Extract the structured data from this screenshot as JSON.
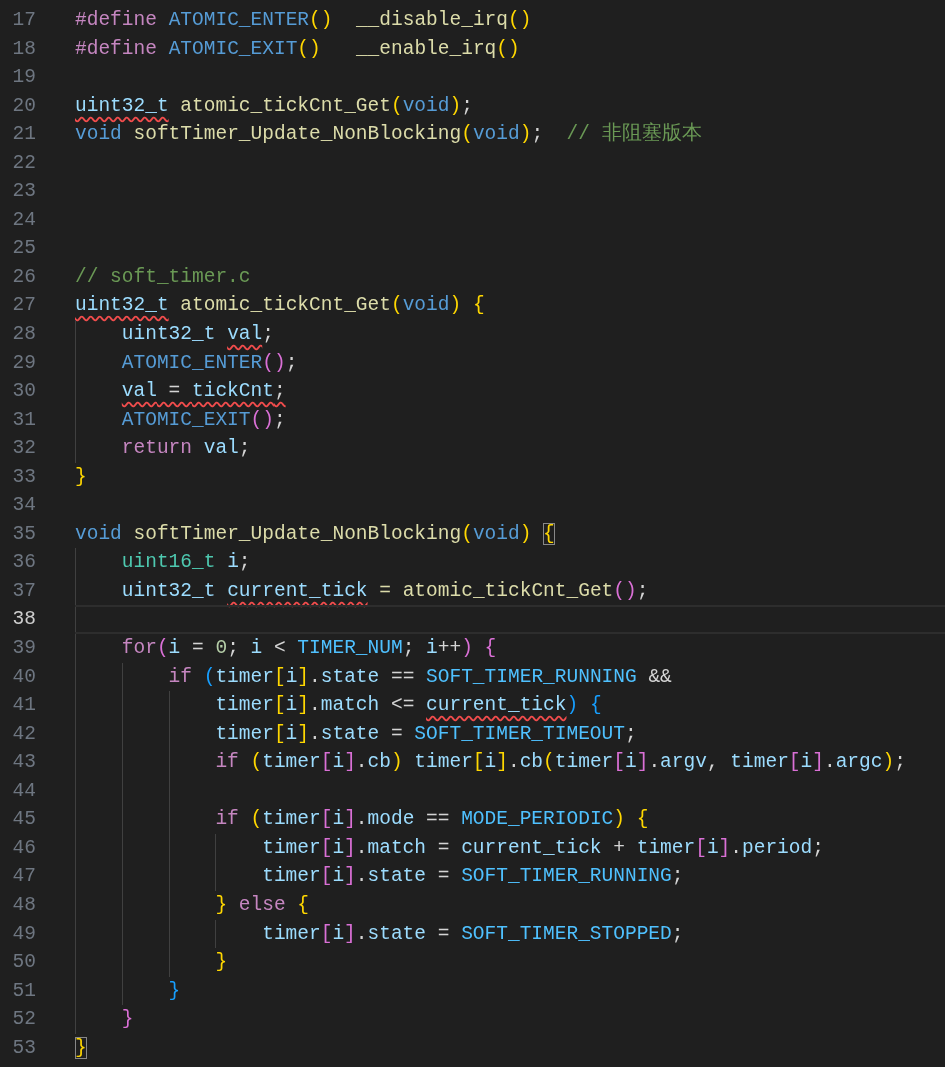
{
  "editor": {
    "lines": [
      {
        "number": "17",
        "current": false,
        "tokens": [
          {
            "text": "#define ",
            "kind": "keyword",
            "squiggle": false,
            "matched": false
          },
          {
            "text": "ATOMIC_ENTER",
            "kind": "macro",
            "squiggle": false,
            "matched": false
          },
          {
            "text": "()  ",
            "kind": "bracket1",
            "squiggle": false,
            "matched": false
          },
          {
            "text": "__disable_irq",
            "kind": "function",
            "squiggle": false,
            "matched": false
          },
          {
            "text": "()",
            "kind": "bracket1",
            "squiggle": false,
            "matched": false
          }
        ]
      },
      {
        "number": "18",
        "current": false,
        "tokens": [
          {
            "text": "#define ",
            "kind": "keyword",
            "squiggle": false,
            "matched": false
          },
          {
            "text": "ATOMIC_EXIT",
            "kind": "macro",
            "squiggle": false,
            "matched": false
          },
          {
            "text": "()   ",
            "kind": "bracket1",
            "squiggle": false,
            "matched": false
          },
          {
            "text": "__enable_irq",
            "kind": "function",
            "squiggle": false,
            "matched": false
          },
          {
            "text": "()",
            "kind": "bracket1",
            "squiggle": false,
            "matched": false
          }
        ]
      },
      {
        "number": "19",
        "current": false
      },
      {
        "number": "20",
        "current": false,
        "tokens": [
          {
            "text": "uint32_t",
            "kind": "variable",
            "squiggle": true,
            "matched": false
          },
          {
            "text": " atomic_tickCnt_Get",
            "kind": "function",
            "squiggle": false,
            "matched": false
          },
          {
            "text": "(",
            "kind": "bracket1",
            "squiggle": false,
            "matched": false
          },
          {
            "text": "void",
            "kind": "storage",
            "squiggle": false,
            "matched": false
          },
          {
            "text": ")",
            "kind": "bracket1",
            "squiggle": false,
            "matched": false
          },
          {
            "text": ";",
            "kind": "plain",
            "squiggle": false,
            "matched": false
          }
        ]
      },
      {
        "number": "21",
        "current": false,
        "tokens": [
          {
            "text": "void ",
            "kind": "storage",
            "squiggle": false,
            "matched": false
          },
          {
            "text": "softTimer_Update_NonBlocking",
            "kind": "function",
            "squiggle": false,
            "matched": false
          },
          {
            "text": "(",
            "kind": "bracket1",
            "squiggle": false,
            "matched": false
          },
          {
            "text": "void",
            "kind": "storage",
            "squiggle": false,
            "matched": false
          },
          {
            "text": ")",
            "kind": "bracket1",
            "squiggle": false,
            "matched": false
          },
          {
            "text": ";  ",
            "kind": "plain",
            "squiggle": false,
            "matched": false
          },
          {
            "text": "// 非阻塞版本",
            "kind": "comment",
            "squiggle": false,
            "matched": false
          }
        ]
      },
      {
        "number": "22",
        "current": false
      },
      {
        "number": "23",
        "current": false
      },
      {
        "number": "24",
        "current": false
      },
      {
        "number": "25",
        "current": false
      },
      {
        "number": "26",
        "current": false,
        "tokens": [
          {
            "text": "// soft_timer.c",
            "kind": "comment",
            "squiggle": false,
            "matched": false
          }
        ]
      },
      {
        "number": "27",
        "current": false,
        "tokens": [
          {
            "text": "uint32_t",
            "kind": "variable",
            "squiggle": true,
            "matched": false
          },
          {
            "text": " atomic_tickCnt_Get",
            "kind": "function",
            "squiggle": false,
            "matched": false
          },
          {
            "text": "(",
            "kind": "bracket1",
            "squiggle": false,
            "matched": false
          },
          {
            "text": "void",
            "kind": "storage",
            "squiggle": false,
            "matched": false
          },
          {
            "text": ") ",
            "kind": "bracket1",
            "squiggle": false,
            "matched": false
          },
          {
            "text": "{",
            "kind": "bracket1",
            "squiggle": false,
            "matched": false
          }
        ]
      },
      {
        "number": "28",
        "current": false,
        "tokens": [
          {
            "text": "    uint32_t ",
            "kind": "variable",
            "squiggle": false,
            "matched": false
          },
          {
            "text": "val",
            "kind": "variable",
            "squiggle": true,
            "matched": false
          },
          {
            "text": ";",
            "kind": "plain",
            "squiggle": false,
            "matched": false
          }
        ]
      },
      {
        "number": "29",
        "current": false,
        "tokens": [
          {
            "text": "    ATOMIC_ENTER",
            "kind": "macro",
            "squiggle": false,
            "matched": false
          },
          {
            "text": "()",
            "kind": "bracket2",
            "squiggle": false,
            "matched": false
          },
          {
            "text": ";",
            "kind": "plain",
            "squiggle": false,
            "matched": false
          }
        ]
      },
      {
        "number": "30",
        "current": false,
        "tokens": [
          {
            "text": "    val",
            "kind": "variable",
            "squiggle": true,
            "matched": false
          },
          {
            "text": " = ",
            "kind": "plain",
            "squiggle": true,
            "matched": false
          },
          {
            "text": "tickCnt",
            "kind": "variable",
            "squiggle": true,
            "matched": false
          },
          {
            "text": ";",
            "kind": "plain",
            "squiggle": true,
            "matched": false
          }
        ]
      },
      {
        "number": "31",
        "current": false,
        "tokens": [
          {
            "text": "    ATOMIC_EXIT",
            "kind": "macro",
            "squiggle": false,
            "matched": false
          },
          {
            "text": "()",
            "kind": "bracket2",
            "squiggle": false,
            "matched": false
          },
          {
            "text": ";",
            "kind": "plain",
            "squiggle": false,
            "matched": false
          }
        ]
      },
      {
        "number": "32",
        "current": false,
        "tokens": [
          {
            "text": "    return ",
            "kind": "keyword",
            "squiggle": false,
            "matched": false
          },
          {
            "text": "val",
            "kind": "variable",
            "squiggle": false,
            "matched": false
          },
          {
            "text": ";",
            "kind": "plain",
            "squiggle": false,
            "matched": false
          }
        ]
      },
      {
        "number": "33",
        "current": false,
        "tokens": [
          {
            "text": "}",
            "kind": "bracket1",
            "squiggle": false,
            "matched": false
          }
        ]
      },
      {
        "number": "34",
        "current": false
      },
      {
        "number": "35",
        "current": false,
        "tokens": [
          {
            "text": "void ",
            "kind": "storage",
            "squiggle": false,
            "matched": false
          },
          {
            "text": "softTimer_Update_NonBlocking",
            "kind": "function",
            "squiggle": false,
            "matched": false
          },
          {
            "text": "(",
            "kind": "bracket1",
            "squiggle": false,
            "matched": false
          },
          {
            "text": "void",
            "kind": "storage",
            "squiggle": false,
            "matched": false
          },
          {
            "text": ") ",
            "kind": "bracket1",
            "squiggle": false,
            "matched": false
          },
          {
            "text": "{",
            "kind": "bracket1",
            "squiggle": false,
            "matched": true
          }
        ]
      },
      {
        "number": "36",
        "current": false,
        "tokens": [
          {
            "text": "    uint16_t ",
            "kind": "type",
            "squiggle": false,
            "matched": false
          },
          {
            "text": "i",
            "kind": "variable",
            "squiggle": false,
            "matched": false
          },
          {
            "text": ";",
            "kind": "plain",
            "squiggle": false,
            "matched": false
          }
        ]
      },
      {
        "number": "37",
        "current": false,
        "tokens": [
          {
            "text": "    uint32_t ",
            "kind": "variable",
            "squiggle": false,
            "matched": false
          },
          {
            "text": "current_tick",
            "kind": "variable",
            "squiggle": true,
            "matched": false
          },
          {
            "text": " = atomic_tickCnt_Get",
            "kind": "function",
            "squiggle": false,
            "matched": false
          },
          {
            "text": "()",
            "kind": "bracket2",
            "squiggle": false,
            "matched": false
          },
          {
            "text": ";",
            "kind": "plain",
            "squiggle": false,
            "matched": false
          }
        ]
      },
      {
        "number": "38",
        "current": true
      },
      {
        "number": "39",
        "current": false,
        "tokens": [
          {
            "text": "    for",
            "kind": "keyword",
            "squiggle": false,
            "matched": false
          },
          {
            "text": "(",
            "kind": "bracket2",
            "squiggle": false,
            "matched": false
          },
          {
            "text": "i",
            "kind": "variable",
            "squiggle": false,
            "matched": false
          },
          {
            "text": " = ",
            "kind": "plain",
            "squiggle": false,
            "matched": false
          },
          {
            "text": "0",
            "kind": "number",
            "squiggle": false,
            "matched": false
          },
          {
            "text": "; ",
            "kind": "plain",
            "squiggle": false,
            "matched": false
          },
          {
            "text": "i",
            "kind": "variable",
            "squiggle": false,
            "matched": false
          },
          {
            "text": " < ",
            "kind": "plain",
            "squiggle": false,
            "matched": false
          },
          {
            "text": "TIMER_NUM",
            "kind": "constant",
            "squiggle": false,
            "matched": false
          },
          {
            "text": "; ",
            "kind": "plain",
            "squiggle": false,
            "matched": false
          },
          {
            "text": "i",
            "kind": "variable",
            "squiggle": false,
            "matched": false
          },
          {
            "text": "++",
            "kind": "plain",
            "squiggle": false,
            "matched": false
          },
          {
            "text": ") ",
            "kind": "bracket2",
            "squiggle": false,
            "matched": false
          },
          {
            "text": "{",
            "kind": "bracket2",
            "squiggle": false,
            "matched": false
          }
        ]
      },
      {
        "number": "40",
        "current": false,
        "tokens": [
          {
            "text": "        if ",
            "kind": "keyword",
            "squiggle": false,
            "matched": false
          },
          {
            "text": "(",
            "kind": "bracket3",
            "squiggle": false,
            "matched": false
          },
          {
            "text": "timer",
            "kind": "variable",
            "squiggle": false,
            "matched": false
          },
          {
            "text": "[",
            "kind": "bracket1",
            "squiggle": false,
            "matched": false
          },
          {
            "text": "i",
            "kind": "variable",
            "squiggle": false,
            "matched": false
          },
          {
            "text": "]",
            "kind": "bracket1",
            "squiggle": false,
            "matched": false
          },
          {
            "text": ".",
            "kind": "plain",
            "squiggle": false,
            "matched": false
          },
          {
            "text": "state",
            "kind": "variable",
            "squiggle": false,
            "matched": false
          },
          {
            "text": " == ",
            "kind": "plain",
            "squiggle": false,
            "matched": false
          },
          {
            "text": "SOFT_TIMER_RUNNING",
            "kind": "constant",
            "squiggle": false,
            "matched": false
          },
          {
            "text": " &&",
            "kind": "plain",
            "squiggle": false,
            "matched": false
          }
        ]
      },
      {
        "number": "41",
        "current": false,
        "tokens": [
          {
            "text": "            timer",
            "kind": "variable",
            "squiggle": false,
            "matched": false
          },
          {
            "text": "[",
            "kind": "bracket1",
            "squiggle": false,
            "matched": false
          },
          {
            "text": "i",
            "kind": "variable",
            "squiggle": false,
            "matched": false
          },
          {
            "text": "]",
            "kind": "bracket1",
            "squiggle": false,
            "matched": false
          },
          {
            "text": ".",
            "kind": "plain",
            "squiggle": false,
            "matched": false
          },
          {
            "text": "match",
            "kind": "variable",
            "squiggle": false,
            "matched": false
          },
          {
            "text": " <= ",
            "kind": "plain",
            "squiggle": false,
            "matched": false
          },
          {
            "text": "current_tick",
            "kind": "variable",
            "squiggle": true,
            "matched": false
          },
          {
            "text": ") ",
            "kind": "bracket3",
            "squiggle": false,
            "matched": false
          },
          {
            "text": "{",
            "kind": "bracket3",
            "squiggle": false,
            "matched": false
          }
        ]
      },
      {
        "number": "42",
        "current": false,
        "tokens": [
          {
            "text": "            timer",
            "kind": "variable",
            "squiggle": false,
            "matched": false
          },
          {
            "text": "[",
            "kind": "bracket1",
            "squiggle": false,
            "matched": false
          },
          {
            "text": "i",
            "kind": "variable",
            "squiggle": false,
            "matched": false
          },
          {
            "text": "]",
            "kind": "bracket1",
            "squiggle": false,
            "matched": false
          },
          {
            "text": ".",
            "kind": "plain",
            "squiggle": false,
            "matched": false
          },
          {
            "text": "state",
            "kind": "variable",
            "squiggle": false,
            "matched": false
          },
          {
            "text": " = ",
            "kind": "plain",
            "squiggle": false,
            "matched": false
          },
          {
            "text": "SOFT_TIMER_TIMEOUT",
            "kind": "constant",
            "squiggle": false,
            "matched": false
          },
          {
            "text": ";",
            "kind": "plain",
            "squiggle": false,
            "matched": false
          }
        ]
      },
      {
        "number": "43",
        "current": false,
        "tokens": [
          {
            "text": "            if ",
            "kind": "keyword",
            "squiggle": false,
            "matched": false
          },
          {
            "text": "(",
            "kind": "bracket1",
            "squiggle": false,
            "matched": false
          },
          {
            "text": "timer",
            "kind": "variable",
            "squiggle": false,
            "matched": false
          },
          {
            "text": "[",
            "kind": "bracket2",
            "squiggle": false,
            "matched": false
          },
          {
            "text": "i",
            "kind": "variable",
            "squiggle": false,
            "matched": false
          },
          {
            "text": "]",
            "kind": "bracket2",
            "squiggle": false,
            "matched": false
          },
          {
            "text": ".",
            "kind": "plain",
            "squiggle": false,
            "matched": false
          },
          {
            "text": "cb",
            "kind": "variable",
            "squiggle": false,
            "matched": false
          },
          {
            "text": ") ",
            "kind": "bracket1",
            "squiggle": false,
            "matched": false
          },
          {
            "text": "timer",
            "kind": "variable",
            "squiggle": false,
            "matched": false
          },
          {
            "text": "[",
            "kind": "bracket1",
            "squiggle": false,
            "matched": false
          },
          {
            "text": "i",
            "kind": "variable",
            "squiggle": false,
            "matched": false
          },
          {
            "text": "]",
            "kind": "bracket1",
            "squiggle": false,
            "matched": false
          },
          {
            "text": ".",
            "kind": "plain",
            "squiggle": false,
            "matched": false
          },
          {
            "text": "cb",
            "kind": "variable",
            "squiggle": false,
            "matched": false
          },
          {
            "text": "(",
            "kind": "bracket1",
            "squiggle": false,
            "matched": false
          },
          {
            "text": "timer",
            "kind": "variable",
            "squiggle": false,
            "matched": false
          },
          {
            "text": "[",
            "kind": "bracket2",
            "squiggle": false,
            "matched": false
          },
          {
            "text": "i",
            "kind": "variable",
            "squiggle": false,
            "matched": false
          },
          {
            "text": "]",
            "kind": "bracket2",
            "squiggle": false,
            "matched": false
          },
          {
            "text": ".",
            "kind": "plain",
            "squiggle": false,
            "matched": false
          },
          {
            "text": "argv",
            "kind": "variable",
            "squiggle": false,
            "matched": false
          },
          {
            "text": ", ",
            "kind": "plain",
            "squiggle": false,
            "matched": false
          },
          {
            "text": "timer",
            "kind": "variable",
            "squiggle": false,
            "matched": false
          },
          {
            "text": "[",
            "kind": "bracket2",
            "squiggle": false,
            "matched": false
          },
          {
            "text": "i",
            "kind": "variable",
            "squiggle": false,
            "matched": false
          },
          {
            "text": "]",
            "kind": "bracket2",
            "squiggle": false,
            "matched": false
          },
          {
            "text": ".",
            "kind": "plain",
            "squiggle": false,
            "matched": false
          },
          {
            "text": "argc",
            "kind": "variable",
            "squiggle": false,
            "matched": false
          },
          {
            "text": ")",
            "kind": "bracket1",
            "squiggle": false,
            "matched": false
          },
          {
            "text": ";",
            "kind": "plain",
            "squiggle": false,
            "matched": false
          }
        ]
      },
      {
        "number": "44",
        "current": false
      },
      {
        "number": "45",
        "current": false,
        "tokens": [
          {
            "text": "            if ",
            "kind": "keyword",
            "squiggle": false,
            "matched": false
          },
          {
            "text": "(",
            "kind": "bracket1",
            "squiggle": false,
            "matched": false
          },
          {
            "text": "timer",
            "kind": "variable",
            "squiggle": false,
            "matched": false
          },
          {
            "text": "[",
            "kind": "bracket2",
            "squiggle": false,
            "matched": false
          },
          {
            "text": "i",
            "kind": "variable",
            "squiggle": false,
            "matched": false
          },
          {
            "text": "]",
            "kind": "bracket2",
            "squiggle": false,
            "matched": false
          },
          {
            "text": ".",
            "kind": "plain",
            "squiggle": false,
            "matched": false
          },
          {
            "text": "mode",
            "kind": "variable",
            "squiggle": false,
            "matched": false
          },
          {
            "text": " == ",
            "kind": "plain",
            "squiggle": false,
            "matched": false
          },
          {
            "text": "MODE_PERIODIC",
            "kind": "constant",
            "squiggle": false,
            "matched": false
          },
          {
            "text": ") ",
            "kind": "bracket1",
            "squiggle": false,
            "matched": false
          },
          {
            "text": "{",
            "kind": "bracket1",
            "squiggle": false,
            "matched": false
          }
        ]
      },
      {
        "number": "46",
        "current": false,
        "tokens": [
          {
            "text": "                timer",
            "kind": "variable",
            "squiggle": false,
            "matched": false
          },
          {
            "text": "[",
            "kind": "bracket2",
            "squiggle": false,
            "matched": false
          },
          {
            "text": "i",
            "kind": "variable",
            "squiggle": false,
            "matched": false
          },
          {
            "text": "]",
            "kind": "bracket2",
            "squiggle": false,
            "matched": false
          },
          {
            "text": ".",
            "kind": "plain",
            "squiggle": false,
            "matched": false
          },
          {
            "text": "match",
            "kind": "variable",
            "squiggle": false,
            "matched": false
          },
          {
            "text": " = ",
            "kind": "plain",
            "squiggle": false,
            "matched": false
          },
          {
            "text": "current_tick",
            "kind": "variable",
            "squiggle": false,
            "matched": false
          },
          {
            "text": " + ",
            "kind": "plain",
            "squiggle": false,
            "matched": false
          },
          {
            "text": "timer",
            "kind": "variable",
            "squiggle": false,
            "matched": false
          },
          {
            "text": "[",
            "kind": "bracket2",
            "squiggle": false,
            "matched": false
          },
          {
            "text": "i",
            "kind": "variable",
            "squiggle": false,
            "matched": false
          },
          {
            "text": "]",
            "kind": "bracket2",
            "squiggle": false,
            "matched": false
          },
          {
            "text": ".",
            "kind": "plain",
            "squiggle": false,
            "matched": false
          },
          {
            "text": "period",
            "kind": "variable",
            "squiggle": false,
            "matched": false
          },
          {
            "text": ";",
            "kind": "plain",
            "squiggle": false,
            "matched": false
          }
        ]
      },
      {
        "number": "47",
        "current": false,
        "tokens": [
          {
            "text": "                timer",
            "kind": "variable",
            "squiggle": false,
            "matched": false
          },
          {
            "text": "[",
            "kind": "bracket2",
            "squiggle": false,
            "matched": false
          },
          {
            "text": "i",
            "kind": "variable",
            "squiggle": false,
            "matched": false
          },
          {
            "text": "]",
            "kind": "bracket2",
            "squiggle": false,
            "matched": false
          },
          {
            "text": ".",
            "kind": "plain",
            "squiggle": false,
            "matched": false
          },
          {
            "text": "state",
            "kind": "variable",
            "squiggle": false,
            "matched": false
          },
          {
            "text": " = ",
            "kind": "plain",
            "squiggle": false,
            "matched": false
          },
          {
            "text": "SOFT_TIMER_RUNNING",
            "kind": "constant",
            "squiggle": false,
            "matched": false
          },
          {
            "text": ";",
            "kind": "plain",
            "squiggle": false,
            "matched": false
          }
        ]
      },
      {
        "number": "48",
        "current": false,
        "tokens": [
          {
            "text": "            } ",
            "kind": "bracket1",
            "squiggle": false,
            "matched": false
          },
          {
            "text": "else ",
            "kind": "keyword",
            "squiggle": false,
            "matched": false
          },
          {
            "text": "{",
            "kind": "bracket1",
            "squiggle": false,
            "matched": false
          }
        ]
      },
      {
        "number": "49",
        "current": false,
        "tokens": [
          {
            "text": "                timer",
            "kind": "variable",
            "squiggle": false,
            "matched": false
          },
          {
            "text": "[",
            "kind": "bracket2",
            "squiggle": false,
            "matched": false
          },
          {
            "text": "i",
            "kind": "variable",
            "squiggle": false,
            "matched": false
          },
          {
            "text": "]",
            "kind": "bracket2",
            "squiggle": false,
            "matched": false
          },
          {
            "text": ".",
            "kind": "plain",
            "squiggle": false,
            "matched": false
          },
          {
            "text": "state",
            "kind": "variable",
            "squiggle": false,
            "matched": false
          },
          {
            "text": " = ",
            "kind": "plain",
            "squiggle": false,
            "matched": false
          },
          {
            "text": "SOFT_TIMER_STOPPED",
            "kind": "constant",
            "squiggle": false,
            "matched": false
          },
          {
            "text": ";",
            "kind": "plain",
            "squiggle": false,
            "matched": false
          }
        ]
      },
      {
        "number": "50",
        "current": false,
        "tokens": [
          {
            "text": "            }",
            "kind": "bracket1",
            "squiggle": false,
            "matched": false
          }
        ]
      },
      {
        "number": "51",
        "current": false,
        "tokens": [
          {
            "text": "        }",
            "kind": "bracket3",
            "squiggle": false,
            "matched": false
          }
        ]
      },
      {
        "number": "52",
        "current": false,
        "tokens": [
          {
            "text": "    }",
            "kind": "bracket2",
            "squiggle": false,
            "matched": false
          }
        ]
      },
      {
        "number": "53",
        "current": false,
        "tokens": [
          {
            "text": "}",
            "kind": "bracket1",
            "squiggle": false,
            "matched": true
          }
        ]
      }
    ]
  }
}
